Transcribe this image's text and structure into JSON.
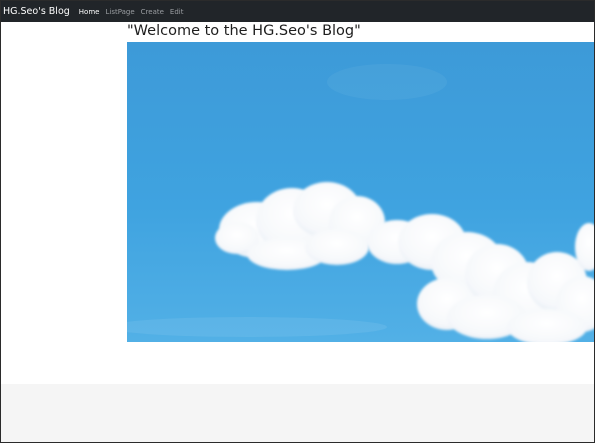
{
  "navbar": {
    "brand": "HG.Seo's Blog",
    "links": [
      {
        "label": "Home",
        "active": true
      },
      {
        "label": "ListPage",
        "active": false
      },
      {
        "label": "Create",
        "active": false
      },
      {
        "label": "Edit",
        "active": false
      }
    ]
  },
  "main": {
    "title": "\"Welcome to the HG.Seo's Blog\""
  },
  "colors": {
    "navbar_bg": "#212529",
    "sky": "#3f9fdb",
    "footer_bg": "#f5f5f5"
  }
}
